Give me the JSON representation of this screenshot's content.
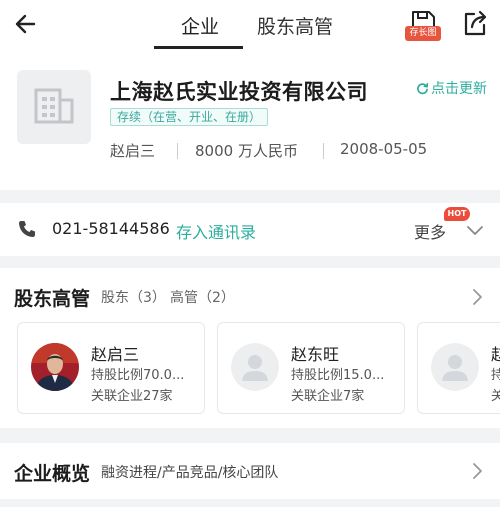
{
  "header": {
    "tabs": [
      {
        "label": "企业",
        "active": true
      },
      {
        "label": "股东高管",
        "active": false
      }
    ],
    "save_badge": "存长图"
  },
  "company": {
    "name": "上海赵氏实业投资有限公司",
    "refresh_label": "点击更新",
    "status": "存续（在营、开业、在册）",
    "legal_rep": "赵启三",
    "capital": "8000 万人民币",
    "founded": "2008-05-05"
  },
  "contact": {
    "phone": "021-58144586",
    "save_label": "存入通讯录",
    "more_label": "更多",
    "hot_badge": "HOT"
  },
  "holders": {
    "title": "股东高管",
    "tab_shareholders": "股东（3）",
    "tab_executives": "高管（2）",
    "cards": [
      {
        "name": "赵启三",
        "ratio": "持股比例70.0...",
        "related": "关联企业27家"
      },
      {
        "name": "赵东旺",
        "ratio": "持股比例15.0...",
        "related": "关联企业7家"
      },
      {
        "name": "赵",
        "ratio": "持",
        "related": "关"
      }
    ]
  },
  "overview": {
    "title": "企业概览",
    "subtitle": "融资进程/产品竞品/核心团队"
  },
  "colors": {
    "accent": "#2cae9e",
    "badge_red": "#e8553f",
    "background": "#f2f3f5"
  }
}
